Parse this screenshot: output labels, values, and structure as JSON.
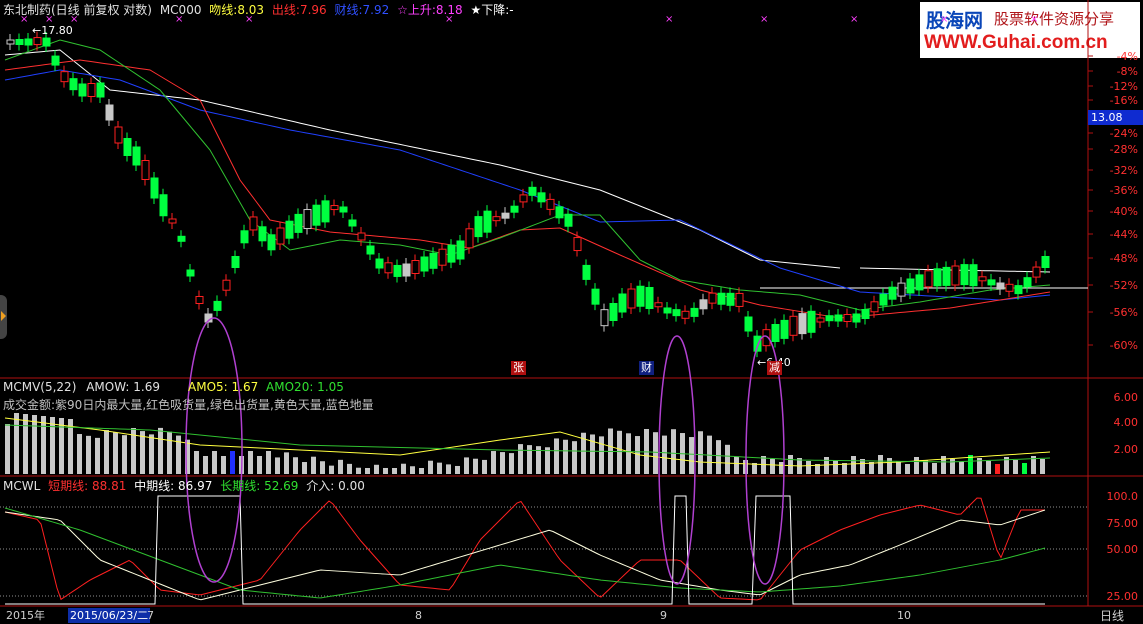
{
  "header": {
    "title": "东北制药(日线 前复权 对数)",
    "indicator": "MC000",
    "wen_label": "吻线:",
    "wen_value": "8.03",
    "chu_label": "出线:",
    "chu_value": "7.96",
    "hui_label": "财线:",
    "hui_value": "7.92",
    "up_label": "☆上升:",
    "up_value": "8.18",
    "down_label": "★下降:",
    "down_value": "-"
  },
  "logo": {
    "name": "股海网",
    "tagline": "股票软件资源分享",
    "url": "WWW.Guhai.com.cn"
  },
  "main_axis": [
    "-4%",
    "-8%",
    "-12%",
    "-16%",
    "-24%",
    "-28%",
    "-32%",
    "-36%",
    "-40%",
    "-44%",
    "-48%",
    "-52%",
    "-56%",
    "-60%"
  ],
  "price_tag": "13.08",
  "high_label": "17.80",
  "low_label": "6.40",
  "markers": [
    "张",
    "财",
    "减"
  ],
  "volume_panel": {
    "name": "MCMV(5,22)",
    "amow": "AMOW: 1.69",
    "amo5": "AMO5: 1.67",
    "amo20": "AMO20: 1.05",
    "legend": "成交金额:紫90日内最大量,红色吸货量,绿色出货量,黄色天量,蓝色地量",
    "axis": [
      "6.00",
      "4.00",
      "2.00"
    ]
  },
  "mcwl_panel": {
    "name": "MCWL",
    "short_label": "短期线: 88.81",
    "mid_label": "中期线: 86.97",
    "long_label": "长期线: 52.69",
    "entry_label": "介入: 0.00",
    "axis": [
      "100.0",
      "75.00",
      "50.00",
      "25.00"
    ]
  },
  "footer": {
    "year": "2015年",
    "selected_date": "2015/06/23/二",
    "month_7": "7",
    "month_8": "8",
    "month_9": "9",
    "month_10": "10",
    "period": "日线"
  },
  "colors": {
    "up": "#ff2020",
    "down": "#00ff40",
    "grey": "#c8c8c8",
    "frame": "#b01010",
    "ma_white": "#ffffff",
    "ma_red": "#ff3030",
    "ma_green": "#30c030",
    "ma_blue": "#2040ff",
    "highlight": "#b040d0"
  }
}
